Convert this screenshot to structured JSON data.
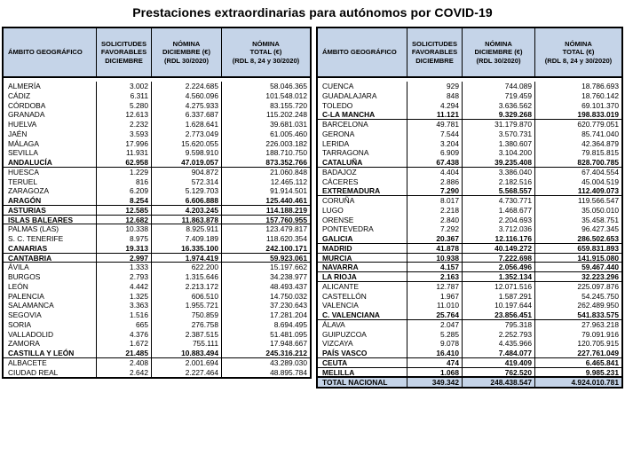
{
  "title": "Prestaciones extraordinarias para autónomos por COVID-19",
  "headers": {
    "region": "ÁMBITO GEOGRÁFICO",
    "solicitudes": [
      "SOLICITUDES",
      "FAVORABLES",
      "DICIEMBRE"
    ],
    "nomina_dic": [
      "NÓMINA",
      "DICIEMBRE (€)",
      "(RDL 30/2020)"
    ],
    "nomina_total": [
      "NÓMINA",
      "TOTAL (€)",
      "(RDL 8, 24 y 30/2020)"
    ]
  },
  "left_rows": [
    {
      "region": "ALMERÍA",
      "solicitudes": "3.002",
      "nomina_dic": "2.224.685",
      "nomina_total": "58.046.365"
    },
    {
      "region": "CÁDIZ",
      "solicitudes": "6.311",
      "nomina_dic": "4.560.096",
      "nomina_total": "101.548.012"
    },
    {
      "region": "CÓRDOBA",
      "solicitudes": "5.280",
      "nomina_dic": "4.275.933",
      "nomina_total": "83.155.720"
    },
    {
      "region": "GRANADA",
      "solicitudes": "12.613",
      "nomina_dic": "6.337.687",
      "nomina_total": "115.202.248"
    },
    {
      "region": "HUELVA",
      "solicitudes": "2.232",
      "nomina_dic": "1.628.641",
      "nomina_total": "39.681.031"
    },
    {
      "region": "JAÉN",
      "solicitudes": "3.593",
      "nomina_dic": "2.773.049",
      "nomina_total": "61.005.460"
    },
    {
      "region": "MÁLAGA",
      "solicitudes": "17.996",
      "nomina_dic": "15.620.055",
      "nomina_total": "226.003.182"
    },
    {
      "region": "SEVILLA",
      "solicitudes": "11.931",
      "nomina_dic": "9.598.910",
      "nomina_total": "188.710.750"
    },
    {
      "region": "ANDALUCÍA",
      "solicitudes": "62.958",
      "nomina_dic": "47.019.057",
      "nomina_total": "873.352.766",
      "bold": true,
      "sep": true
    },
    {
      "region": "HUESCA",
      "solicitudes": "1.229",
      "nomina_dic": "904.872",
      "nomina_total": "21.060.848"
    },
    {
      "region": "TERUEL",
      "solicitudes": "816",
      "nomina_dic": "572.314",
      "nomina_total": "12.465.112"
    },
    {
      "region": "ZARAGOZA",
      "solicitudes": "6.209",
      "nomina_dic": "5.129.703",
      "nomina_total": "91.914.501"
    },
    {
      "region": "ARAGÓN",
      "solicitudes": "8.254",
      "nomina_dic": "6.606.888",
      "nomina_total": "125.440.461",
      "bold": true,
      "sep": true
    },
    {
      "region": "ASTURIAS",
      "solicitudes": "12.585",
      "nomina_dic": "4.203.245",
      "nomina_total": "114.188.219",
      "bold": true,
      "sep": true
    },
    {
      "region": "ISLAS BALEARES",
      "solicitudes": "12.682",
      "nomina_dic": "11.863.878",
      "nomina_total": "157.760.955",
      "bold": true,
      "sep": true
    },
    {
      "region": "PALMAS (LAS)",
      "solicitudes": "10.338",
      "nomina_dic": "8.925.911",
      "nomina_total": "123.479.817"
    },
    {
      "region": "S. C. TENERIFE",
      "solicitudes": "8.975",
      "nomina_dic": "7.409.189",
      "nomina_total": "118.620.354"
    },
    {
      "region": "CANARIAS",
      "solicitudes": "19.313",
      "nomina_dic": "16.335.100",
      "nomina_total": "242.100.171",
      "bold": true,
      "sep": true
    },
    {
      "region": "CANTABRIA",
      "solicitudes": "2.997",
      "nomina_dic": "1.974.419",
      "nomina_total": "59.923.061",
      "bold": true,
      "sep": true
    },
    {
      "region": "ÁVILA",
      "solicitudes": "1.333",
      "nomina_dic": "622.200",
      "nomina_total": "15.197.662"
    },
    {
      "region": "BURGOS",
      "solicitudes": "2.793",
      "nomina_dic": "1.315.646",
      "nomina_total": "34.238.977"
    },
    {
      "region": "LEÓN",
      "solicitudes": "4.442",
      "nomina_dic": "2.213.172",
      "nomina_total": "48.493.437"
    },
    {
      "region": "PALENCIA",
      "solicitudes": "1.325",
      "nomina_dic": "606.510",
      "nomina_total": "14.750.032"
    },
    {
      "region": "SALAMANCA",
      "solicitudes": "3.363",
      "nomina_dic": "1.955.721",
      "nomina_total": "37.230.643"
    },
    {
      "region": "SEGOVIA",
      "solicitudes": "1.516",
      "nomina_dic": "750.859",
      "nomina_total": "17.281.204"
    },
    {
      "region": "SORIA",
      "solicitudes": "665",
      "nomina_dic": "276.758",
      "nomina_total": "8.694.495"
    },
    {
      "region": "VALLADOLID",
      "solicitudes": "4.376",
      "nomina_dic": "2.387.515",
      "nomina_total": "51.481.095"
    },
    {
      "region": "ZAMORA",
      "solicitudes": "1.672",
      "nomina_dic": "755.111",
      "nomina_total": "17.948.667"
    },
    {
      "region": "CASTILLA Y LEÓN",
      "solicitudes": "21.485",
      "nomina_dic": "10.883.494",
      "nomina_total": "245.316.212",
      "bold": true,
      "sep": true
    },
    {
      "region": "ALBACETE",
      "solicitudes": "2.408",
      "nomina_dic": "2.001.694",
      "nomina_total": "43.289.030"
    },
    {
      "region": "CIUDAD REAL",
      "solicitudes": "2.642",
      "nomina_dic": "2.227.464",
      "nomina_total": "48.895.784"
    }
  ],
  "right_rows": [
    {
      "region": "CUENCA",
      "solicitudes": "929",
      "nomina_dic": "744.089",
      "nomina_total": "18.786.693"
    },
    {
      "region": "GUADALAJARA",
      "solicitudes": "848",
      "nomina_dic": "719.459",
      "nomina_total": "18.760.142"
    },
    {
      "region": "TOLEDO",
      "solicitudes": "4.294",
      "nomina_dic": "3.636.562",
      "nomina_total": "69.101.370"
    },
    {
      "region": "C-LA MANCHA",
      "solicitudes": "11.121",
      "nomina_dic": "9.329.268",
      "nomina_total": "198.833.019",
      "bold": true,
      "sep": true
    },
    {
      "region": "BARCELONA",
      "solicitudes": "49.781",
      "nomina_dic": "31.179.870",
      "nomina_total": "620.779.051"
    },
    {
      "region": "GERONA",
      "solicitudes": "7.544",
      "nomina_dic": "3.570.731",
      "nomina_total": "85.741.040"
    },
    {
      "region": "LERIDA",
      "solicitudes": "3.204",
      "nomina_dic": "1.380.607",
      "nomina_total": "42.364.879"
    },
    {
      "region": "TARRAGONA",
      "solicitudes": "6.909",
      "nomina_dic": "3.104.200",
      "nomina_total": "79.815.815"
    },
    {
      "region": "CATALUÑA",
      "solicitudes": "67.438",
      "nomina_dic": "39.235.408",
      "nomina_total": "828.700.785",
      "bold": true,
      "sep": true
    },
    {
      "region": "BADAJOZ",
      "solicitudes": "4.404",
      "nomina_dic": "3.386.040",
      "nomina_total": "67.404.554"
    },
    {
      "region": "CÁCERES",
      "solicitudes": "2.886",
      "nomina_dic": "2.182.516",
      "nomina_total": "45.004.519"
    },
    {
      "region": "EXTREMADURA",
      "solicitudes": "7.290",
      "nomina_dic": "5.568.557",
      "nomina_total": "112.409.073",
      "bold": true,
      "sep": true
    },
    {
      "region": "CORUÑA",
      "solicitudes": "8.017",
      "nomina_dic": "4.730.771",
      "nomina_total": "119.566.547"
    },
    {
      "region": "LUGO",
      "solicitudes": "2.218",
      "nomina_dic": "1.468.677",
      "nomina_total": "35.050.010"
    },
    {
      "region": "ORENSE",
      "solicitudes": "2.840",
      "nomina_dic": "2.204.693",
      "nomina_total": "35.458.751"
    },
    {
      "region": "PONTEVEDRA",
      "solicitudes": "7.292",
      "nomina_dic": "3.712.036",
      "nomina_total": "96.427.345"
    },
    {
      "region": "GALICIA",
      "solicitudes": "20.367",
      "nomina_dic": "12.116.176",
      "nomina_total": "286.502.653",
      "bold": true,
      "sep": true
    },
    {
      "region": "MADRID",
      "solicitudes": "41.878",
      "nomina_dic": "40.149.272",
      "nomina_total": "659.831.893",
      "bold": true,
      "sep": true
    },
    {
      "region": "MURCIA",
      "solicitudes": "10.938",
      "nomina_dic": "7.222.698",
      "nomina_total": "141.915.080",
      "bold": true,
      "sep": true
    },
    {
      "region": "NAVARRA",
      "solicitudes": "4.157",
      "nomina_dic": "2.056.496",
      "nomina_total": "59.467.440",
      "bold": true,
      "sep": true
    },
    {
      "region": "LA RIOJA",
      "solicitudes": "2.163",
      "nomina_dic": "1.352.134",
      "nomina_total": "32.223.296",
      "bold": true,
      "sep": true
    },
    {
      "region": "ALICANTE",
      "solicitudes": "12.787",
      "nomina_dic": "12.071.516",
      "nomina_total": "225.097.876"
    },
    {
      "region": "CASTELLÓN",
      "solicitudes": "1.967",
      "nomina_dic": "1.587.291",
      "nomina_total": "54.245.750"
    },
    {
      "region": "VALENCIA",
      "solicitudes": "11.010",
      "nomina_dic": "10.197.644",
      "nomina_total": "262.489.950"
    },
    {
      "region": "C. VALENCIANA",
      "solicitudes": "25.764",
      "nomina_dic": "23.856.451",
      "nomina_total": "541.833.575",
      "bold": true,
      "sep": true
    },
    {
      "region": "ÁLAVA",
      "solicitudes": "2.047",
      "nomina_dic": "795.318",
      "nomina_total": "27.963.218"
    },
    {
      "region": "GUIPUZCOA",
      "solicitudes": "5.285",
      "nomina_dic": "2.252.793",
      "nomina_total": "79.091.916"
    },
    {
      "region": "VIZCAYA",
      "solicitudes": "9.078",
      "nomina_dic": "4.435.966",
      "nomina_total": "120.705.915"
    },
    {
      "region": "PAÍS VASCO",
      "solicitudes": "16.410",
      "nomina_dic": "7.484.077",
      "nomina_total": "227.761.049",
      "bold": true,
      "sep": true
    },
    {
      "region": "CEUTA",
      "solicitudes": "474",
      "nomina_dic": "419.409",
      "nomina_total": "6.465.841",
      "bold": true,
      "sep": true
    },
    {
      "region": "MELILLA",
      "solicitudes": "1.068",
      "nomina_dic": "762.520",
      "nomina_total": "9.985.231",
      "bold": true,
      "sep": true
    },
    {
      "region": "TOTAL NACIONAL",
      "solicitudes": "349.342",
      "nomina_dic": "248.438.547",
      "nomina_total": "4.924.010.781",
      "total": true
    }
  ],
  "colors": {
    "header_bg": "#c5d4e8",
    "border": "#000000"
  }
}
